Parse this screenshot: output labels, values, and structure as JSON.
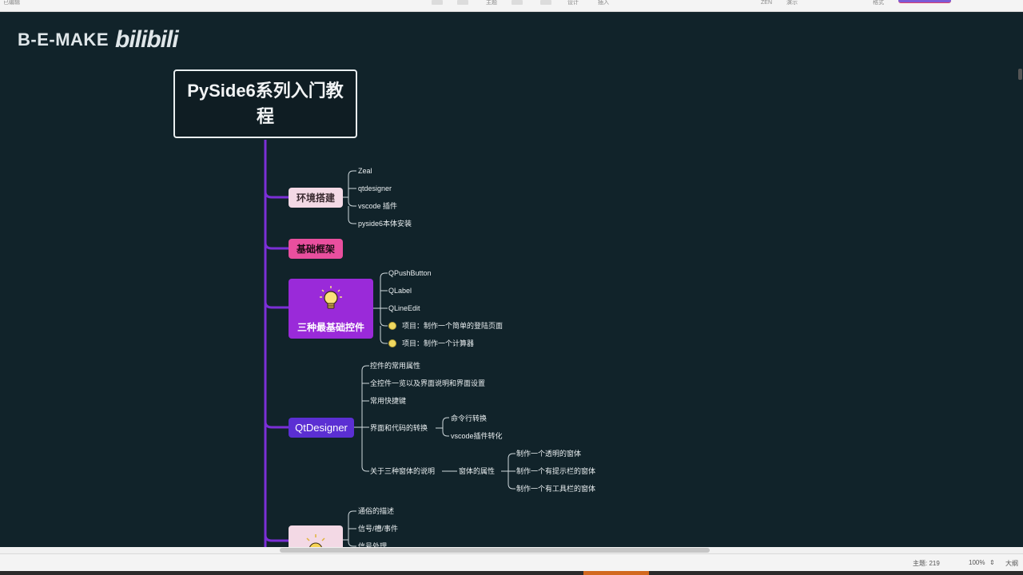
{
  "toolbar": {
    "window_label": "已编辑",
    "items": [
      "主题",
      "设计",
      "插入",
      "ZEN",
      "演示",
      "格式"
    ]
  },
  "watermark": {
    "text": "B-E-MAKE",
    "logo": "bilibili"
  },
  "mindmap": {
    "root": "PySide6系列入门教程",
    "env": {
      "label": "环境搭建",
      "leaves": [
        "Zeal",
        "qtdesigner",
        "vscode 插件",
        "pyside6本体安装"
      ]
    },
    "base": {
      "label": "基础框架"
    },
    "controls": {
      "label": "三种最基础控件",
      "icon": "lightbulb-icon",
      "leaves": [
        "QPushButton",
        "QLabel",
        "QLineEdit"
      ],
      "projects": [
        "项目：制作一个简单的登陆页面",
        "项目：制作一个计算器"
      ]
    },
    "qtdesigner": {
      "label": "QtDesigner",
      "leaves": [
        "控件的常用属性",
        "全控件一览以及界面说明和界面设置",
        "常用快捷键"
      ],
      "convert": {
        "label": "界面和代码的转换",
        "children": [
          "命令行转换",
          "vscode插件转化"
        ]
      },
      "windows": {
        "label": "关于三种窗体的说明",
        "sub": "窗体的属性",
        "children": [
          "制作一个透明的窗体",
          "制作一个有提示栏的窗体",
          "制作一个有工具栏的窗体"
        ]
      }
    },
    "signals": {
      "icon": "sun-icon",
      "leaves": [
        "通俗的描述",
        "信号/槽/事件",
        "信号处理"
      ]
    }
  },
  "status": {
    "topic_count": "主题: 219",
    "zoom": "100%",
    "size_label": "大纲"
  },
  "colors": {
    "background": "#11232a",
    "trunk": "#7b2fd6",
    "env": "#f3d9e5",
    "base": "#e94f9e",
    "controls": "#9a2ad9",
    "qtdesigner": "#5b2fd3"
  }
}
